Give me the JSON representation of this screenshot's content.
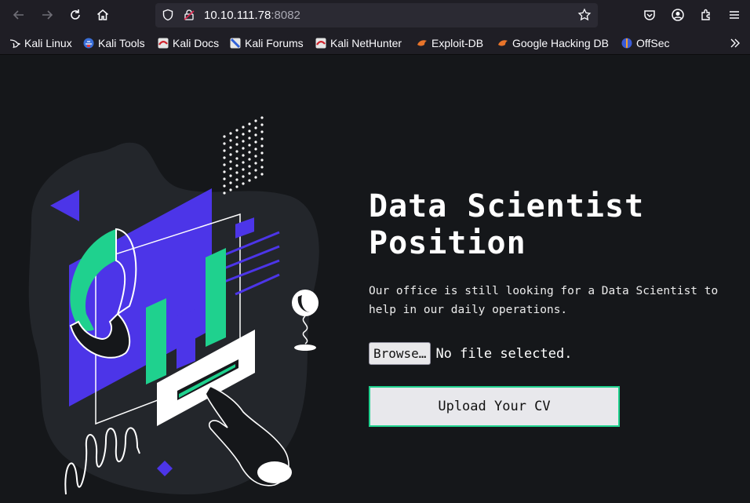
{
  "browser": {
    "url_host": "10.10.111.78",
    "url_port": ":8082",
    "bookmarks": [
      {
        "label": "Kali Linux",
        "icon": "kali-dragon-icon"
      },
      {
        "label": "Kali Tools",
        "icon": "kali-tools-icon"
      },
      {
        "label": "Kali Docs",
        "icon": "kali-docs-icon"
      },
      {
        "label": "Kali Forums",
        "icon": "kali-forums-icon"
      },
      {
        "label": "Kali NetHunter",
        "icon": "kali-nethunter-icon"
      },
      {
        "label": "Exploit-DB",
        "icon": "exploit-db-icon"
      },
      {
        "label": "Google Hacking DB",
        "icon": "ghdb-icon"
      },
      {
        "label": "OffSec",
        "icon": "offsec-icon"
      }
    ]
  },
  "page": {
    "title": "Data Scientist Position",
    "description": "Our office is still looking for a Data Scientist to help in our daily operations.",
    "browse_label": "Browse…",
    "file_status": "No file selected.",
    "upload_label": "Upload Your CV"
  },
  "colors": {
    "accent_green": "#1fd18e",
    "accent_purple": "#4c35e8",
    "background": "#15171a"
  }
}
